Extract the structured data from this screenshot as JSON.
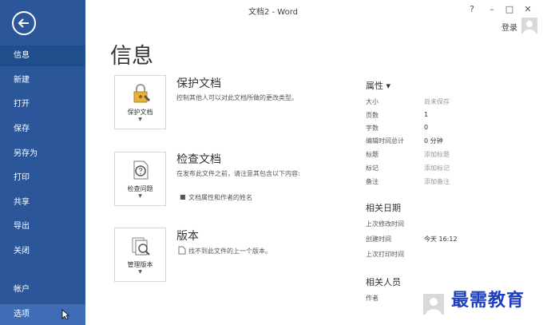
{
  "window": {
    "title": "文档2 - Word",
    "help": "?",
    "minimize": "–",
    "maximize": "□",
    "close": "✕",
    "signin": "登录"
  },
  "sidebar": {
    "items": [
      {
        "label": "信息"
      },
      {
        "label": "新建"
      },
      {
        "label": "打开"
      },
      {
        "label": "保存"
      },
      {
        "label": "另存为"
      },
      {
        "label": "打印"
      },
      {
        "label": "共享"
      },
      {
        "label": "导出"
      },
      {
        "label": "关闭"
      },
      {
        "label": "帐户"
      },
      {
        "label": "选项"
      }
    ]
  },
  "page": {
    "title": "信息"
  },
  "sections": [
    {
      "card_label": "保护文档",
      "title": "保护文档",
      "desc": "控制其他人可以对此文档所做的更改类型。"
    },
    {
      "card_label": "检查问题",
      "title": "检查文档",
      "desc": "在发布此文件之前，请注意其包含以下内容:",
      "bullet": "文档属性和作者的姓名"
    },
    {
      "card_label": "管理版本",
      "title": "版本",
      "desc": "找不到此文件的上一个版本。"
    }
  ],
  "properties": {
    "header": "属性 ▾",
    "rows": [
      {
        "key": "大小",
        "value": "尚未保存"
      },
      {
        "key": "页数",
        "value": "1"
      },
      {
        "key": "字数",
        "value": "0"
      },
      {
        "key": "编辑时间总计",
        "value": "0 分钟"
      },
      {
        "key": "标题",
        "value": "添加标题"
      },
      {
        "key": "标记",
        "value": "添加标记"
      },
      {
        "key": "备注",
        "value": "添加备注"
      }
    ]
  },
  "dates": {
    "header": "相关日期",
    "rows": [
      {
        "key": "上次修改时间",
        "value": ""
      },
      {
        "key": "创建时间",
        "value": "今天 16:12"
      },
      {
        "key": "上次打印时间",
        "value": ""
      }
    ]
  },
  "people": {
    "header": "相关人员",
    "rows": [
      {
        "key": "作者"
      }
    ]
  },
  "watermark": "最需教育",
  "colors": {
    "sidebar": "#2b579a",
    "active": "#1e4e8c",
    "watermark": "#1e3ec0"
  }
}
